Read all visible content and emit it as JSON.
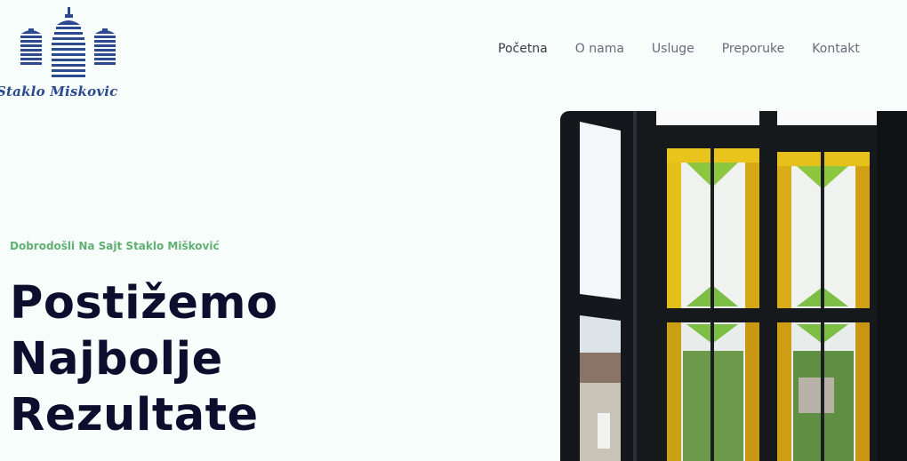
{
  "logo": {
    "text": "Staklo Miskovic",
    "icon": "buildings-icon"
  },
  "nav": {
    "items": [
      {
        "label": "Početna",
        "active": true
      },
      {
        "label": "O nama",
        "active": false
      },
      {
        "label": "Usluge",
        "active": false
      },
      {
        "label": "Preporuke",
        "active": false
      },
      {
        "label": "Kontakt",
        "active": false
      }
    ]
  },
  "hero": {
    "subtitle": "Dobrodošli Na Sajt Staklo Mišković",
    "title_lines": [
      "Postižemo",
      "Najbolje",
      "Rezultate"
    ],
    "image": "stained-glass-window-photo"
  },
  "colors": {
    "background": "#f7fdfb",
    "brand": "#2d4a90",
    "accent_green": "#5fb072",
    "heading": "#0b0e2c",
    "nav_text": "#6a6a78"
  }
}
